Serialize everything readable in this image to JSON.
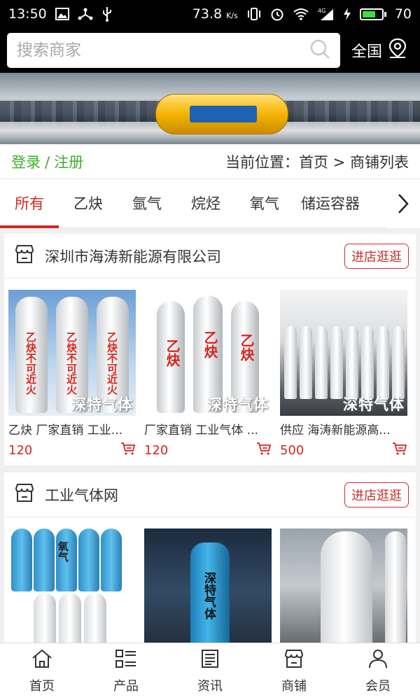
{
  "status_bar": {
    "time": "13:50",
    "speed": "73.8",
    "speed_unit": "K/s",
    "network": "4G",
    "battery": "70",
    "battery_fraction": 0.7
  },
  "search": {
    "placeholder": "搜索商家",
    "region_label": "全国"
  },
  "breadcrumb": {
    "login": "登录",
    "separator": "/",
    "register": "注册",
    "location_prefix": "当前位置：",
    "home": "首页",
    "arrow": ">",
    "current": "商铺列表"
  },
  "tabs": [
    {
      "label": "所有",
      "active": true
    },
    {
      "label": "乙炔",
      "active": false
    },
    {
      "label": "氩气",
      "active": false
    },
    {
      "label": "烷烃",
      "active": false
    },
    {
      "label": "氧气",
      "active": false
    },
    {
      "label": "储运容器",
      "active": false
    }
  ],
  "shops": [
    {
      "name": "深圳市海涛新能源有限公司",
      "visit_label": "进店逛逛",
      "products": [
        {
          "name": "乙炔 厂家直销 工业...",
          "price": "120",
          "watermark": "深特气体",
          "image_text": "乙炔不可近火"
        },
        {
          "name": "厂家直销 工业气体 ...",
          "price": "120",
          "watermark": "深特气体",
          "image_text": "乙炔"
        },
        {
          "name": "供应 海涛新能源高...",
          "price": "500",
          "watermark": "深特气体",
          "image_text": ""
        }
      ]
    },
    {
      "name": "工业气体网",
      "visit_label": "进店逛逛",
      "products": [
        {
          "name": "",
          "price": "",
          "watermark": "",
          "image_text": "氧气"
        },
        {
          "name": "",
          "price": "",
          "watermark": "",
          "image_text": "深特气体"
        },
        {
          "name": "",
          "price": "",
          "watermark": "",
          "image_text": ""
        }
      ]
    }
  ],
  "bottom_nav": [
    {
      "label": "首页",
      "icon": "home-icon"
    },
    {
      "label": "产品",
      "icon": "list-icon"
    },
    {
      "label": "资讯",
      "icon": "news-icon"
    },
    {
      "label": "商铺",
      "icon": "shop-icon"
    },
    {
      "label": "会员",
      "icon": "user-icon"
    }
  ],
  "colors": {
    "accent": "#d7261f",
    "login_green": "#3fae29",
    "header_bg": "#000000"
  }
}
